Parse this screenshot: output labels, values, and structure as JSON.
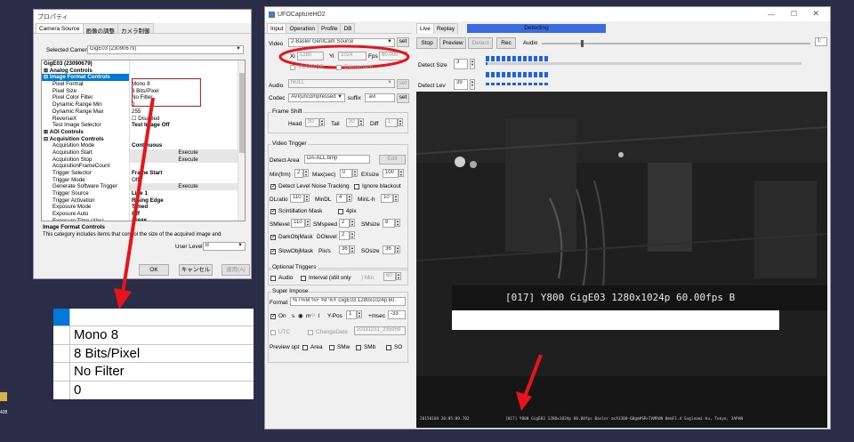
{
  "properties": {
    "title": "プロパティ",
    "tabs": [
      "Camera Source",
      "画像の調整",
      "カメラ制御"
    ],
    "selected_camera_label": "Selected Camera",
    "selected_camera_value": "GigE03 (23090679)",
    "grid_rows": [
      {
        "key": "GigE03 (23090679)",
        "value": "",
        "type": "cat"
      },
      {
        "key": "⊞ Analog Controls",
        "value": "",
        "type": "cat"
      },
      {
        "key": "⊟ Image Format Controls",
        "value": "",
        "type": "sel"
      },
      {
        "key": "Pixel Format",
        "value": "Mono 8",
        "type": "item"
      },
      {
        "key": "Pixel Size",
        "value": "8 Bits/Pixel",
        "type": "item"
      },
      {
        "key": "Pixel Color Filter",
        "value": "No Filter",
        "type": "item"
      },
      {
        "key": "Dynamic Range Min",
        "value": "0",
        "type": "item"
      },
      {
        "key": "Dynamic Range Max",
        "value": "255",
        "type": "item"
      },
      {
        "key": "ReverseX",
        "value": "☐ Disabled",
        "type": "item"
      },
      {
        "key": "Test Image Selector",
        "value": "Test Image Off",
        "type": "bold"
      },
      {
        "key": "⊞ AOI Controls",
        "value": "",
        "type": "cat"
      },
      {
        "key": "⊟ Acquisition Controls",
        "value": "",
        "type": "cat"
      },
      {
        "key": "Acquisition Mode",
        "value": "Continuous",
        "type": "bold"
      },
      {
        "key": "Acquisition Start",
        "value": "Execute",
        "type": "exe"
      },
      {
        "key": "Acquisition Stop",
        "value": "Execute",
        "type": "exe"
      },
      {
        "key": "AcquisitionFrameCount",
        "value": "",
        "type": "item"
      },
      {
        "key": "Trigger Selector",
        "value": "Frame Start",
        "type": "bold"
      },
      {
        "key": "Trigger Mode",
        "value": "Off",
        "type": "item"
      },
      {
        "key": "Generate Software Trigger",
        "value": "Execute",
        "type": "exe"
      },
      {
        "key": "Trigger Source",
        "value": "Line 1",
        "type": "bold"
      },
      {
        "key": "Trigger Activation",
        "value": "Rising Edge",
        "type": "bold"
      },
      {
        "key": "Exposure Mode",
        "value": "Timed",
        "type": "bold"
      },
      {
        "key": "Exposure Auto",
        "value": "Off",
        "type": "bold"
      },
      {
        "key": "Exposure Time (Abs)",
        "value": "16666",
        "type": "bold"
      }
    ],
    "help_title": "Image Format Controls",
    "help_text": "This category includes items that control the size of the acquired image and",
    "user_level_label": "User Level",
    "user_level_value": "B",
    "ok": "OK",
    "cancel": "キャンセル",
    "apply": "適用(A)"
  },
  "magnified": {
    "values": [
      "Mono 8",
      "8 Bits/Pixel",
      "No Filter",
      "0"
    ]
  },
  "ufo": {
    "title": "UFOCaptureHD2",
    "tabs": [
      "Input",
      "Operation",
      "Profile",
      "DB"
    ],
    "video_label": "Video",
    "video_source": "2-Basler GenICam Source",
    "set": "set",
    "xi_label": "Xi",
    "xi": "1280",
    "yi_label": "Yi",
    "yi": "1024",
    "fps_label": "Fps",
    "fps": "60.000",
    "yuv_label": "YUV/RGB",
    "deinterlace_label": "Deinterlace",
    "audio_label": "Audio",
    "audio_value": "NULL",
    "codec_label": "Codec",
    "codec_value": "AVI(uncompressed",
    "suffix_label": "suffix",
    "suffix_value": ".avi",
    "frame_shift": {
      "title": "Frame Shift",
      "head_label": "Head",
      "head": "30",
      "tail_label": "Tail",
      "tail": "30",
      "diff_label": "Diff",
      "diff": "1"
    },
    "video_trigger": {
      "title": "Video Trigger",
      "detect_area_label": "Detect Area",
      "detect_area": "DA-ALL.bmp",
      "edit": "Edit",
      "minfrm_label": "Min(frm)",
      "minfrm": "2",
      "maxsec_label": "Max(sec)",
      "maxsec": "0",
      "exsize_label": "EXsize",
      "exsize": "100",
      "noise_label": "Detect Level Noise Tracking",
      "blackout_label": "Ignore blackout",
      "dlratio_label": "DLratio",
      "dlratio": "110",
      "mindl_label": "MinDL",
      "mindl": "4",
      "minlnh_label": "MinL-h",
      "minlnh": "10",
      "scint_label": "Scintillation Mask",
      "pix4_label": "4pix",
      "smlevel_label": "SMlevel",
      "smlevel": "110",
      "smspeed_label": "SMspeed",
      "smspeed": "2",
      "smsize_label": "SMsize",
      "smsize": "8",
      "darkobj_label": "DarkObjMask",
      "dolevel_label": "DOlevel",
      "dolevel": "2",
      "slowobj_label": "SlowObjMask",
      "pixs_label": "Pix/s",
      "pixs": "36",
      "sosize_label": "SOsize",
      "sosize": "36"
    },
    "optional_triggers": {
      "title": "Optional Triggers",
      "audio_label": "Audio",
      "interval_label": "Interval (still only",
      "min_label": ") Min",
      "min": "60"
    },
    "superimpose": {
      "title": "Super Impose",
      "format_label": "Format",
      "format": "%T%M %F %f %Y GigE03 1280x1024p 60.",
      "on_label": "On",
      "s_label": "s",
      "m_label": "m",
      "l_label": "l",
      "ypos_label": "Y-Pos",
      "ypos": "1",
      "msec_label": "+msec",
      "msec": "-33",
      "utc_label": "UTC",
      "changedate_label": "ChangeDate",
      "changedate": "20111231_235959",
      "preview_label": "Preview opt",
      "area_label": "Area",
      "smw_label": "SMw",
      "smb_label": "SMb",
      "so_label": "SO"
    },
    "right_tabs": [
      "Live",
      "Replay"
    ],
    "status": "Detecting",
    "stop": "Stop",
    "preview": "Preview",
    "detect": "Detect",
    "rec": "Rec",
    "audio_slider_label": "Audio",
    "detect_size_label": "Detect Size",
    "detect_size": "3",
    "detect_lev_label": "Detect Lev",
    "detect_lev": "39",
    "overlay_text": "[017] Y800 GigE03 1280x1024p 60.00fps B",
    "footer_left": "20150104 20:05:09.702",
    "footer_right": "[017] Y800 GigE03 1280x1024p 60.00fps Basler acA1300-60gm#SR+TAMRON 8mmF1.4  Suginami-ku, Tokyo, JAPAN"
  },
  "desktop": {
    "label": "428"
  },
  "colors": {
    "desktop": "#2b2d48",
    "status_blue": "#3a6be0",
    "annotation_red": "#e8141c",
    "selection_blue": "#0078d7"
  }
}
